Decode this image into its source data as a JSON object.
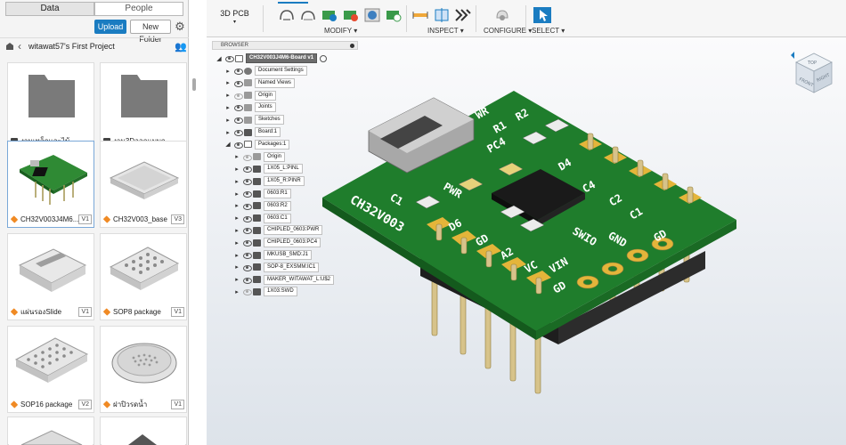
{
  "data_panel": {
    "tabs": [
      "Data",
      "People"
    ],
    "active_tab": "Data",
    "upload_label": "Upload",
    "new_folder_label": "New Folder",
    "project_title": "witawat57's First Project",
    "items": [
      {
        "name": "งานเหล็กและไม้",
        "kind": "folder",
        "version": ""
      },
      {
        "name": "งาน3Dออกแบบก...",
        "kind": "folder",
        "version": ""
      },
      {
        "name": "CH32V003J4M6...",
        "kind": "component",
        "version": "V1"
      },
      {
        "name": "CH32V003_base",
        "kind": "component",
        "version": "V3"
      },
      {
        "name": "แผ่นรองSlide",
        "kind": "component",
        "version": "V1"
      },
      {
        "name": "SOP8 package",
        "kind": "component",
        "version": "V1"
      },
      {
        "name": "SOP16 package",
        "kind": "component",
        "version": "V2"
      },
      {
        "name": "ฝาปิวรดน้ำ",
        "kind": "component",
        "version": "V1"
      }
    ]
  },
  "toolbar": {
    "mode_label": "3D PCB",
    "tab_label": "3D PCB",
    "groups": [
      "MODIFY",
      "INSPECT",
      "CONFIGURE",
      "SELECT"
    ]
  },
  "browser": {
    "title": "BROWSER",
    "root": "CH32V003J4M6-Board v1",
    "items": [
      {
        "label": "Document Settings",
        "level": 1,
        "icon": "gear"
      },
      {
        "label": "Named Views",
        "level": 1,
        "icon": "folder"
      },
      {
        "label": "Origin",
        "level": 1,
        "icon": "folder",
        "dim": true
      },
      {
        "label": "Joints",
        "level": 1,
        "icon": "folder"
      },
      {
        "label": "Sketches",
        "level": 1,
        "icon": "folder"
      },
      {
        "label": "Board:1",
        "level": 1,
        "icon": "body"
      },
      {
        "label": "Packages:1",
        "level": 1,
        "icon": "pkg",
        "open": true
      },
      {
        "label": "Origin",
        "level": 2,
        "icon": "folder",
        "dim": true
      },
      {
        "label": "1X05_L:PINL",
        "level": 2,
        "icon": "body"
      },
      {
        "label": "1X05_R:PINR",
        "level": 2,
        "icon": "body"
      },
      {
        "label": "0603:R1",
        "level": 2,
        "icon": "body"
      },
      {
        "label": "0603:R2",
        "level": 2,
        "icon": "body"
      },
      {
        "label": "0603:C1",
        "level": 2,
        "icon": "body"
      },
      {
        "label": "CHIPLED_0603:PWR",
        "level": 2,
        "icon": "body"
      },
      {
        "label": "CHIPLED_0603:PC4",
        "level": 2,
        "icon": "body"
      },
      {
        "label": "MKUSB_SMD:J1",
        "level": 2,
        "icon": "body"
      },
      {
        "label": "SOP-8_EXSMM:IC1",
        "level": 2,
        "icon": "body"
      },
      {
        "label": "MAKER_WITAWAT_L:U$2",
        "level": 2,
        "icon": "body"
      },
      {
        "label": "1X03:SWD",
        "level": 2,
        "icon": "body",
        "dim": true
      }
    ]
  },
  "pcb": {
    "board_color": "#1f7d2c",
    "silk_labels": [
      "CH32V003",
      "C1",
      "PWR",
      "PC4",
      "R1",
      "R2",
      "WR",
      "D4",
      "C4",
      "C2",
      "C1",
      "GND",
      "GD",
      "D6",
      "GD",
      "A2",
      "VC",
      "VIN",
      "SWIO",
      "GD"
    ],
    "view_cube_labels": [
      "TOP",
      "FRONT",
      "RIGHT"
    ]
  }
}
